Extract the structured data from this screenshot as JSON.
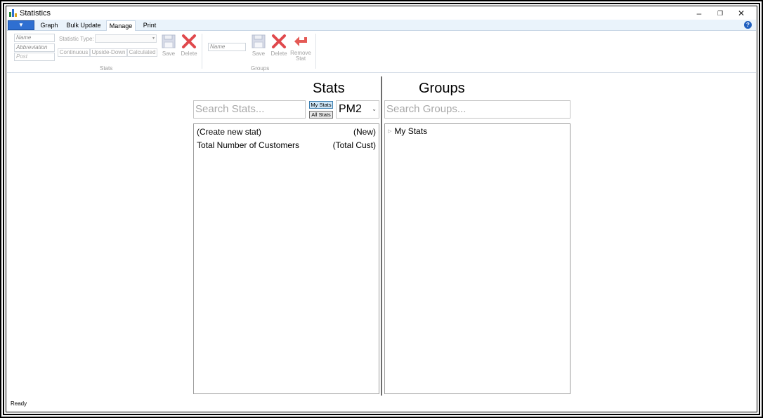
{
  "window": {
    "title": "Statistics",
    "controls": {
      "minimize": "–",
      "restore": "❐",
      "close": "✕"
    }
  },
  "ribbon": {
    "tabs": [
      {
        "label": "Graph"
      },
      {
        "label": "Bulk Update"
      },
      {
        "label": "Manage"
      },
      {
        "label": "Print"
      }
    ],
    "active_tab": "Manage",
    "file_tab_glyph": "▼",
    "help_glyph": "?",
    "stats_group": {
      "name_placeholder": "Name",
      "abbreviation_placeholder": "Abbreviation",
      "post_placeholder": "Post",
      "statistic_type_label": "Statistic Type:",
      "statistic_type_value": "",
      "type_buttons": [
        "Continuous",
        "Upside-Down",
        "Calculated"
      ],
      "save_label": "Save",
      "delete_label": "Delete",
      "group_label": "Stats"
    },
    "groups_group": {
      "name_placeholder": "Name",
      "save_label": "Save",
      "delete_label": "Delete",
      "remove_stat_label_line1": "Remove",
      "remove_stat_label_line2": "Stat",
      "group_label": "Groups"
    }
  },
  "stats_panel": {
    "heading": "Stats",
    "search_placeholder": "Search Stats...",
    "filter_buttons": {
      "my_stats": "My Stats",
      "all_stats": "All Stats"
    },
    "filter_selected": "My Stats",
    "combo_value": "PM2",
    "items": [
      {
        "name": "(Create new stat)",
        "abbrev": "(New)"
      },
      {
        "name": "Total Number of Customers",
        "abbrev": "(Total Cust)"
      }
    ]
  },
  "groups_panel": {
    "heading": "Groups",
    "search_placeholder": "Search Groups...",
    "tree": [
      {
        "label": "My Stats",
        "expander": "▷"
      }
    ]
  },
  "status_bar": {
    "text": "Ready"
  },
  "colors": {
    "accent_blue": "#2f6fd1",
    "delete_red": "#e0484c",
    "ribbon_tab_bg": "#eaf3fb"
  }
}
